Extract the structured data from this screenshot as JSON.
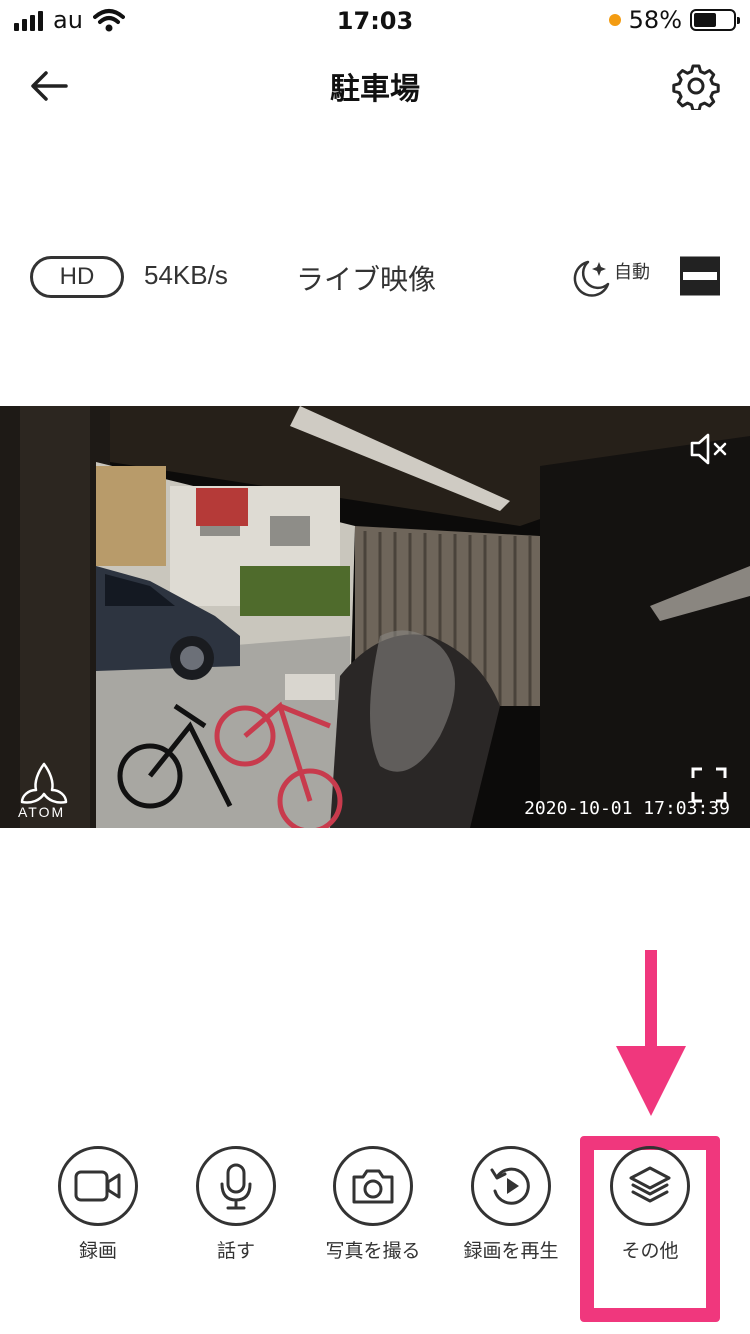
{
  "status_bar": {
    "carrier": "au",
    "time": "17:03",
    "battery": "58%",
    "battery_level": 0.58,
    "recording_dot_color": "#f39c12"
  },
  "nav": {
    "title": "駐車場",
    "back_icon": "arrow-left-icon",
    "settings_icon": "gear-icon"
  },
  "info": {
    "quality": "HD",
    "rate": "54KB/s",
    "mode": "ライブ映像",
    "night_label": "自動",
    "night_icon": "moon-sparkle-icon",
    "layout_icon": "split-view-icon"
  },
  "video": {
    "timestamp": "2020-10-01  17:03:39",
    "brand": "ATOM",
    "mute_icon": "speaker-muted-icon",
    "fullscreen_icon": "fullscreen-icon"
  },
  "toolbar": {
    "items": [
      {
        "label": "録画",
        "icon": "video-camera-icon"
      },
      {
        "label": "話す",
        "icon": "microphone-icon"
      },
      {
        "label": "写真を撮る",
        "icon": "camera-icon"
      },
      {
        "label": "録画を再生",
        "icon": "replay-icon"
      },
      {
        "label": "その他",
        "icon": "layers-icon"
      }
    ]
  },
  "annotation": {
    "color": "#f0377d"
  }
}
